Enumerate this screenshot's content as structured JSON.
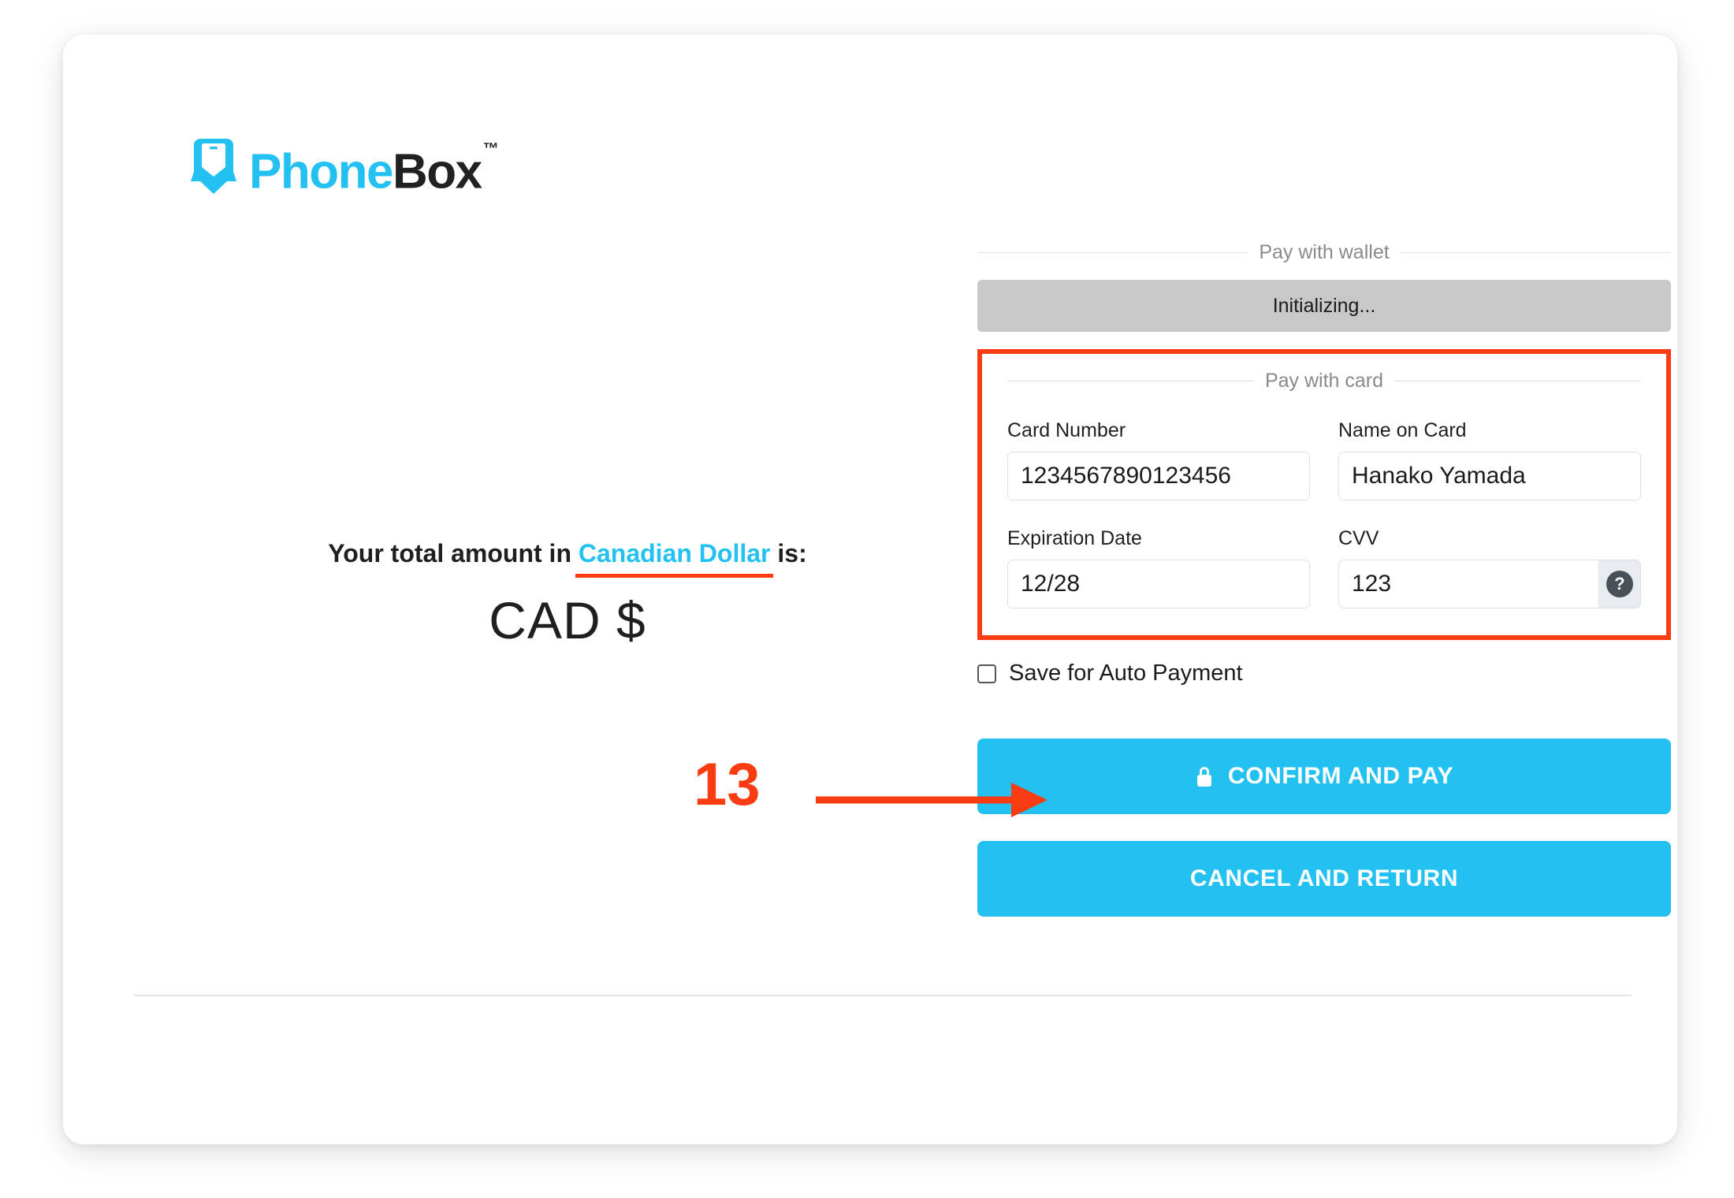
{
  "brand": {
    "name_part1": "Phone",
    "name_part2": "Box",
    "tm": "™",
    "accent_color": "#22C1F2",
    "dark_color": "#212121",
    "logo_icon": "phonebox-speech-bubble-icon"
  },
  "summary": {
    "prefix": "Your total amount in ",
    "currency": "Canadian Dollar",
    "suffix": " is:",
    "amount": "CAD $",
    "underline_color": "#FA3C13"
  },
  "wallet": {
    "legend": "Pay with wallet",
    "button_label": "Initializing..."
  },
  "card_section": {
    "legend": "Pay with card",
    "highlight_color": "#FA3C13",
    "fields": [
      {
        "name": "card-number",
        "label": "Card Number",
        "value": "1234567890123456",
        "placeholder": "Card Number"
      },
      {
        "name": "name-on-card",
        "label": "Name on Card",
        "value": "Hanako Yamada",
        "placeholder": "Name on Card"
      },
      {
        "name": "expiration-date",
        "label": "Expiration Date",
        "value": "12/28",
        "placeholder": "MM/YY"
      },
      {
        "name": "cvv",
        "label": "CVV",
        "value": "123",
        "placeholder": "CVV",
        "addon_icon": "question-mark-icon",
        "addon_glyph": "?"
      }
    ]
  },
  "save_option": {
    "label": "Save for Auto Payment",
    "checked": false
  },
  "actions": {
    "confirm_label": "CONFIRM AND PAY",
    "confirm_icon": "lock-icon",
    "cancel_label": "CANCEL AND RETURN",
    "button_color": "#22C1F2"
  },
  "annotation": {
    "step_number": "13",
    "color": "#FA3C13",
    "target": "confirm-and-pay-button"
  }
}
